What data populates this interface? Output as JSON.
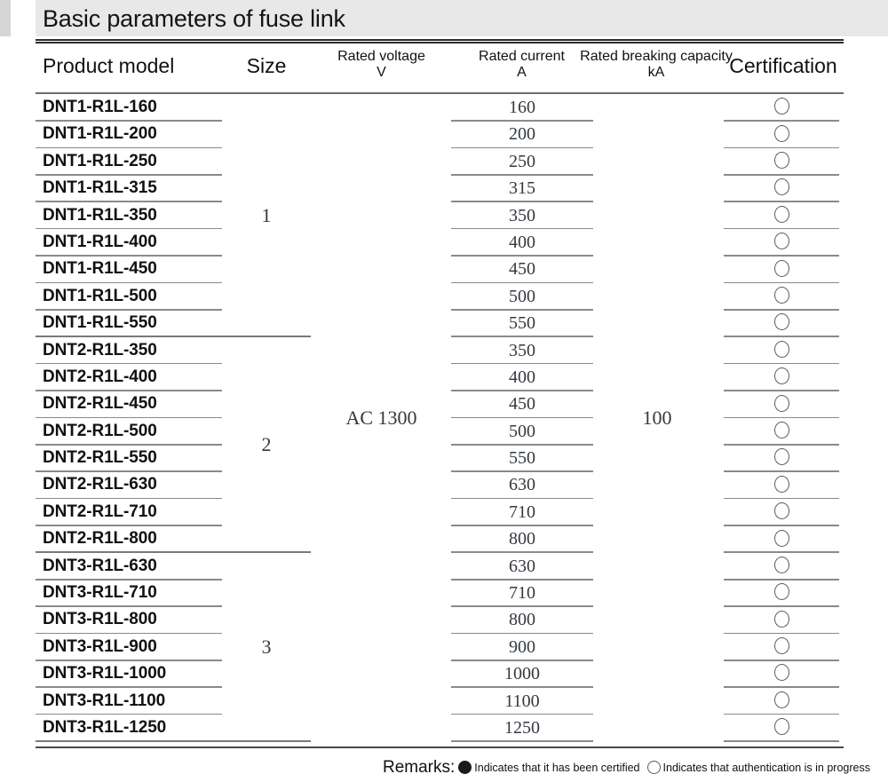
{
  "document": {
    "title": "Basic parameters of fuse link"
  },
  "table": {
    "headers": {
      "model": "Product model",
      "size": "Size",
      "voltage": "Rated voltage",
      "voltage_unit": "V",
      "current": "Rated current",
      "current_unit": "A",
      "breaking": "Rated breaking capacity",
      "breaking_unit": "kA",
      "certification": "Certification"
    },
    "shared": {
      "rated_voltage": "AC 1300",
      "rated_breaking_capacity": "100"
    },
    "groups": [
      {
        "size": "1",
        "rows": [
          {
            "model": "DNT1-R1L-160",
            "current": "160",
            "certification": "open"
          },
          {
            "model": "DNT1-R1L-200",
            "current": "200",
            "certification": "open"
          },
          {
            "model": "DNT1-R1L-250",
            "current": "250",
            "certification": "open"
          },
          {
            "model": "DNT1-R1L-315",
            "current": "315",
            "certification": "open"
          },
          {
            "model": "DNT1-R1L-350",
            "current": "350",
            "certification": "open"
          },
          {
            "model": "DNT1-R1L-400",
            "current": "400",
            "certification": "open"
          },
          {
            "model": "DNT1-R1L-450",
            "current": "450",
            "certification": "open"
          },
          {
            "model": "DNT1-R1L-500",
            "current": "500",
            "certification": "open"
          },
          {
            "model": "DNT1-R1L-550",
            "current": "550",
            "certification": "open"
          }
        ]
      },
      {
        "size": "2",
        "rows": [
          {
            "model": "DNT2-R1L-350",
            "current": "350",
            "certification": "open"
          },
          {
            "model": "DNT2-R1L-400",
            "current": "400",
            "certification": "open"
          },
          {
            "model": "DNT2-R1L-450",
            "current": "450",
            "certification": "open"
          },
          {
            "model": "DNT2-R1L-500",
            "current": "500",
            "certification": "open"
          },
          {
            "model": "DNT2-R1L-550",
            "current": "550",
            "certification": "open"
          },
          {
            "model": "DNT2-R1L-630",
            "current": "630",
            "certification": "open"
          },
          {
            "model": "DNT2-R1L-710",
            "current": "710",
            "certification": "open"
          },
          {
            "model": "DNT2-R1L-800",
            "current": "800",
            "certification": "open"
          }
        ]
      },
      {
        "size": "3",
        "rows": [
          {
            "model": "DNT3-R1L-630",
            "current": "630",
            "certification": "open"
          },
          {
            "model": "DNT3-R1L-710",
            "current": "710",
            "certification": "open"
          },
          {
            "model": "DNT3-R1L-800",
            "current": "800",
            "certification": "open"
          },
          {
            "model": "DNT3-R1L-900",
            "current": "900",
            "certification": "open"
          },
          {
            "model": "DNT3-R1L-1000",
            "current": "1000",
            "certification": "open"
          },
          {
            "model": "DNT3-R1L-1100",
            "current": "1100",
            "certification": "open"
          },
          {
            "model": "DNT3-R1L-1250",
            "current": "1250",
            "certification": "open"
          }
        ]
      }
    ]
  },
  "remarks": {
    "label": "Remarks:",
    "certified_text": "Indicates that it has been certified",
    "pending_text": "Indicates that authentication is in progress"
  }
}
